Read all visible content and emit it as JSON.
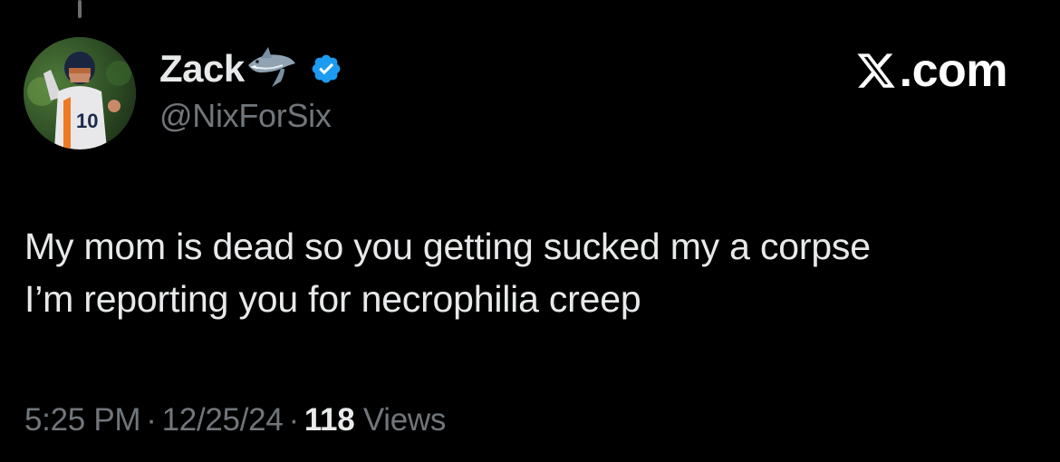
{
  "author": {
    "display_name": "Zack",
    "name_emoji": "shark-emoji",
    "verified": true,
    "handle": "@NixForSix",
    "avatar": "football-player-avatar"
  },
  "watermark": {
    "logo": "x-logo-icon",
    "text": ".com"
  },
  "tweet": {
    "lines": [
      "My mom is dead so you getting sucked my a corpse",
      "I’m reporting you for necrophilia creep"
    ]
  },
  "meta": {
    "time": "5:25 PM",
    "separator": "·",
    "date": "12/25/24",
    "views_count": "118",
    "views_label": "Views"
  },
  "colors": {
    "background": "#000000",
    "text_primary": "#e7e9ea",
    "text_secondary": "#71767b",
    "verified_blue": "#1d9bf0"
  }
}
